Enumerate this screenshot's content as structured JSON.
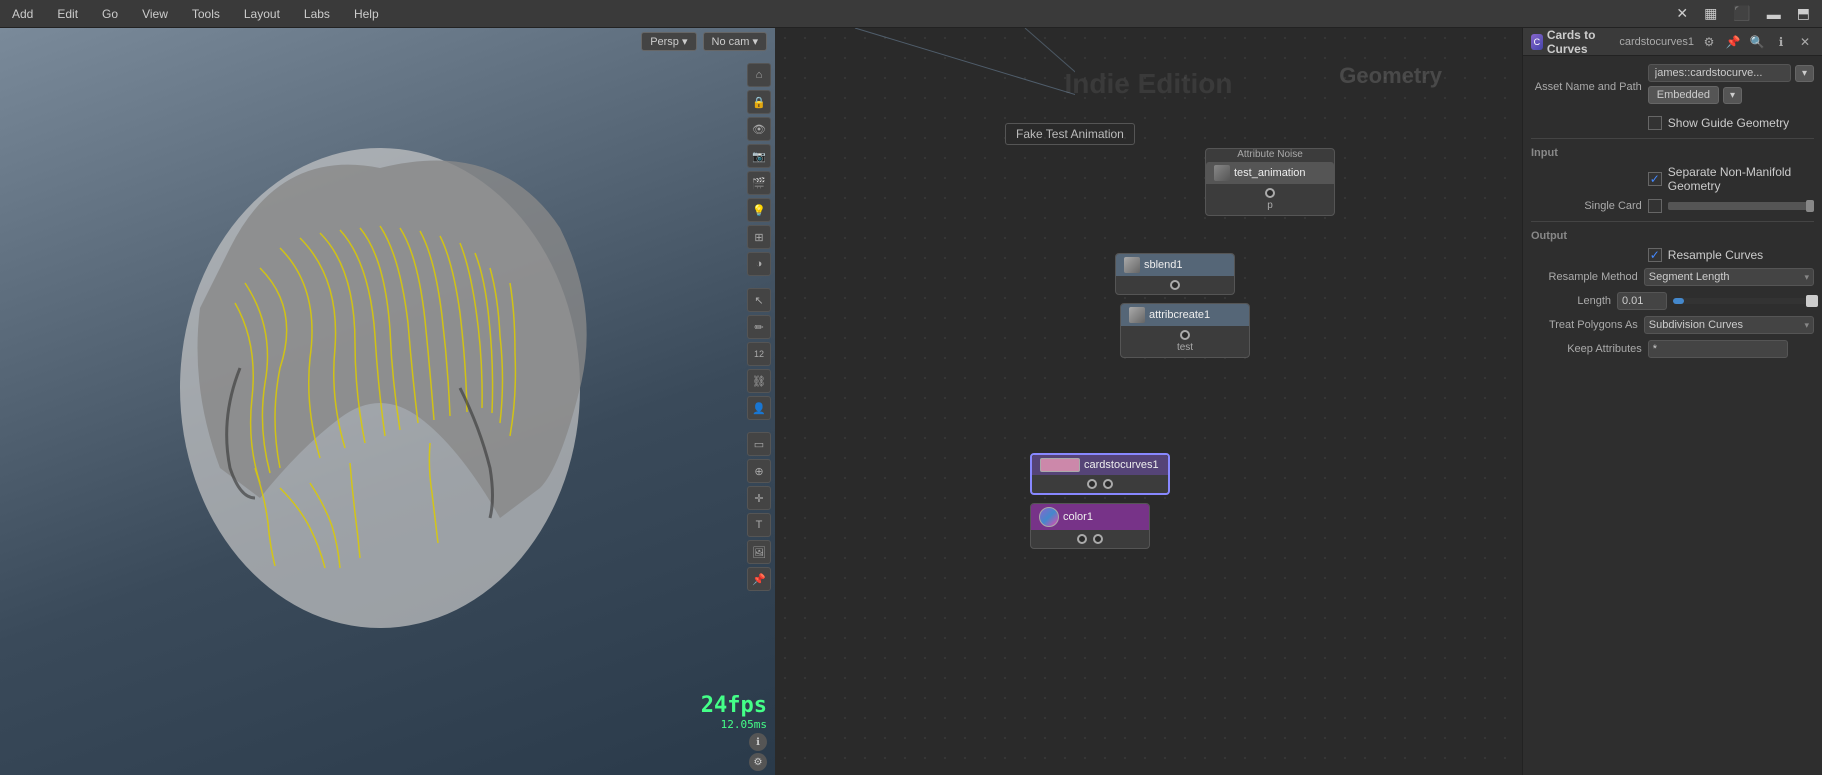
{
  "menubar": {
    "items": [
      "Add",
      "Edit",
      "Go",
      "View",
      "Tools",
      "Layout",
      "Labs",
      "Help"
    ]
  },
  "viewport": {
    "perspective_btn": "Persp ▾",
    "cam_btn": "No cam ▾",
    "fps": "24fps",
    "ms": "12.05ms"
  },
  "node_editor": {
    "watermark": "Indie Edition",
    "geometry_label": "Geometry",
    "fake_anim_label": "Fake Test Animation",
    "nodes": {
      "test_animation": {
        "label_above": "Attribute Noise",
        "name": "test_animation",
        "port_label": "p"
      },
      "sblend1": {
        "name": "sblend1"
      },
      "attribcreate1": {
        "name": "attribcreate1",
        "port_label": "test"
      },
      "cardstocurves1": {
        "name": "cardstocurves1"
      },
      "color1": {
        "name": "color1"
      }
    }
  },
  "properties": {
    "tab_label": "Cards to Curves",
    "node_name": "cardstocurves1",
    "asset_name_label": "Asset Name and Path",
    "asset_path": "james::cardstocurve...",
    "embedded_label": "Embedded",
    "show_guide_geometry_label": "Show Guide Geometry",
    "input_section": "Input",
    "separate_non_manifold_label": "Separate Non-Manifold Geometry",
    "single_card_label": "Single Card",
    "output_section": "Output",
    "resample_curves_label": "Resample Curves",
    "resample_method_label": "Resample Method",
    "resample_method_value": "Segment Length",
    "length_label": "Length",
    "length_value": "0.01",
    "treat_polygons_as_label": "Treat Polygons As",
    "treat_polygons_value": "Subdivision Curves",
    "keep_attributes_label": "Keep Attributes",
    "keep_attributes_value": "*",
    "panel_icons": [
      "⚙",
      "⬛",
      "?",
      "ℹ",
      "✕"
    ]
  }
}
